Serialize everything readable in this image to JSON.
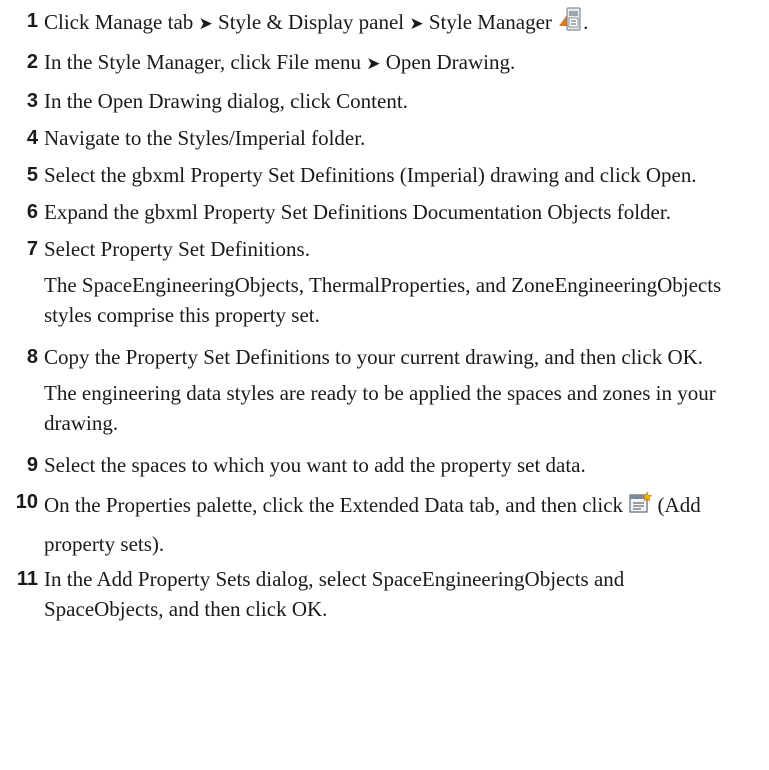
{
  "steps": [
    {
      "num": "1",
      "parts": [
        "Click Manage tab ",
        " Style & Display panel ",
        " Style Manager ",
        "."
      ],
      "arrow": "➤",
      "icon": "style-manager-icon"
    },
    {
      "num": "2",
      "parts": [
        "In the Style Manager, click File menu ",
        " Open Drawing."
      ],
      "arrow": "➤"
    },
    {
      "num": "3",
      "text": "In the Open Drawing dialog, click Content."
    },
    {
      "num": "4",
      "text": "Navigate to the Styles/Imperial folder."
    },
    {
      "num": "5",
      "text": "Select the gbxml Property Set Definitions (Imperial) drawing and click Open."
    },
    {
      "num": "6",
      "text": "Expand the gbxml Property Set Definitions Documentation Objects folder."
    },
    {
      "num": "7",
      "text": "Select Property Set Definitions.",
      "note": "The SpaceEngineeringObjects, ThermalProperties, and ZoneEngineeringObjects styles comprise this property set."
    },
    {
      "num": "8",
      "text": "Copy the Property Set Definitions to your current drawing, and then click OK.",
      "note": "The engineering data styles are ready to be applied the spaces and zones in your drawing."
    },
    {
      "num": "9",
      "text": "Select the spaces to which you want to add the property set data."
    },
    {
      "num": "10",
      "parts": [
        "On the Properties palette, click the Extended Data tab, and then click ",
        " (Add property sets)."
      ],
      "icon": "add-property-sets-icon"
    },
    {
      "num": "11",
      "text": "In the Add Property Sets dialog, select SpaceEngineeringObjects and SpaceObjects, and then click OK."
    }
  ]
}
